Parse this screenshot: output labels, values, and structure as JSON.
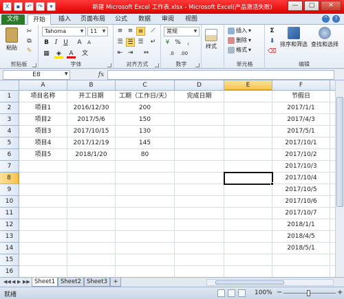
{
  "window": {
    "title": "新建 Microsoft Excel 工作表.xlsx - Microsoft Excel(产品激活失败)",
    "controls": [
      "—",
      "□",
      "✕"
    ]
  },
  "ribbon": {
    "tabs": [
      "文件",
      "开始",
      "插入",
      "页面布局",
      "公式",
      "数据",
      "审阅",
      "视图"
    ],
    "active_tab": "开始",
    "clipboard": {
      "paste": "粘贴",
      "label": "剪贴板"
    },
    "font": {
      "family": "Tahoma",
      "size": "11",
      "bold": "B",
      "italic": "I",
      "underline": "U",
      "grow": "A",
      "shrink": "A",
      "font_color": "A",
      "label": "字体"
    },
    "alignment": {
      "label": "对齐方式"
    },
    "number": {
      "format": "常规",
      "percent": "%",
      "comma": ",",
      "label": "数字"
    },
    "styles": {
      "button": "样式"
    },
    "cells": {
      "insert": "插入",
      "delete": "删除",
      "format": "格式",
      "label": "单元格"
    },
    "editing": {
      "sum": "Σ",
      "sort": "排序和筛选",
      "find": "查找和选择",
      "label": "编辑"
    },
    "accent": "#2a7a2a"
  },
  "formula_bar": {
    "name_box": "E8",
    "fx": "fx",
    "value": ""
  },
  "grid": {
    "columns": [
      "A",
      "B",
      "C",
      "D",
      "E",
      "F"
    ],
    "rows": [
      "1",
      "2",
      "3",
      "4",
      "5",
      "6",
      "7",
      "8",
      "9",
      "10",
      "11",
      "12",
      "13",
      "14",
      "15",
      "16"
    ],
    "selected_cell": "E8",
    "cells": [
      [
        "项目名称",
        "开工日期",
        "工期（工作日/天）",
        "完成日期",
        "",
        "节假日"
      ],
      [
        "项目1",
        "2016/12/30",
        "200",
        "",
        "",
        "2017/1/1"
      ],
      [
        "项目2",
        "2017/5/6",
        "150",
        "",
        "",
        "2017/4/3"
      ],
      [
        "项目3",
        "2017/10/15",
        "130",
        "",
        "",
        "2017/5/1"
      ],
      [
        "项目4",
        "2017/12/19",
        "145",
        "",
        "",
        "2017/10/1"
      ],
      [
        "项目5",
        "2018/1/20",
        "80",
        "",
        "",
        "2017/10/2"
      ],
      [
        "",
        "",
        "",
        "",
        "",
        "2017/10/3"
      ],
      [
        "",
        "",
        "",
        "",
        "",
        "2017/10/4"
      ],
      [
        "",
        "",
        "",
        "",
        "",
        "2017/10/5"
      ],
      [
        "",
        "",
        "",
        "",
        "",
        "2017/10/6"
      ],
      [
        "",
        "",
        "",
        "",
        "",
        "2017/10/7"
      ],
      [
        "",
        "",
        "",
        "",
        "",
        "2018/1/1"
      ],
      [
        "",
        "",
        "",
        "",
        "",
        "2018/4/5"
      ],
      [
        "",
        "",
        "",
        "",
        "",
        "2018/5/1"
      ],
      [
        "",
        "",
        "",
        "",
        "",
        ""
      ],
      [
        "",
        "",
        "",
        "",
        "",
        ""
      ]
    ]
  },
  "sheets": {
    "tabs": [
      "Sheet1",
      "Sheet2",
      "Sheet3"
    ],
    "active": "Sheet1",
    "nav": [
      "◀◀",
      "◀",
      "▶",
      "▶▶"
    ]
  },
  "status_bar": {
    "status": "就绪",
    "zoom": "100%",
    "zoom_out": "−",
    "zoom_in": "+"
  }
}
